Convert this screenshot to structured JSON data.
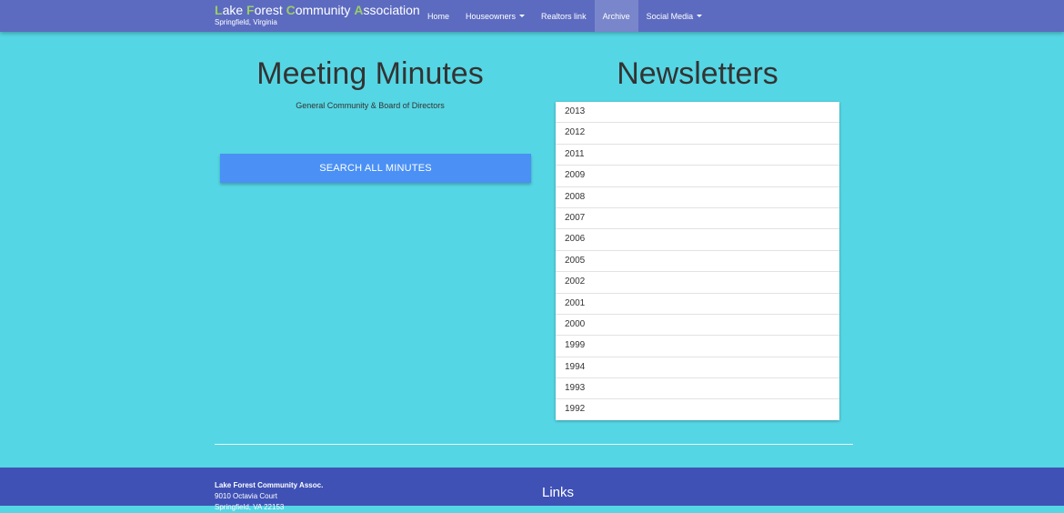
{
  "header": {
    "brand_initials": [
      "L",
      "F",
      "C",
      "A"
    ],
    "brand_rest": [
      "ake ",
      "orest ",
      "ommunity ",
      "ssociation"
    ],
    "brand_subtitle": "Springfield, Virginia",
    "nav": [
      {
        "label": "Home"
      },
      {
        "label": "Houseowners",
        "dropdown": true
      },
      {
        "label": "Realtors link"
      },
      {
        "label": "Archive",
        "active": true
      },
      {
        "label": "Social Media",
        "dropdown": true
      }
    ]
  },
  "minutes": {
    "title": "Meeting Minutes",
    "subtitle": "General Community & Board of Directors",
    "search_button": "SEARCH ALL MINUTES"
  },
  "newsletters": {
    "title": "Newsletters",
    "years": [
      "2013",
      "2012",
      "2011",
      "2009",
      "2008",
      "2007",
      "2006",
      "2005",
      "2002",
      "2001",
      "2000",
      "1999",
      "1994",
      "1993",
      "1992"
    ]
  },
  "footer": {
    "address": [
      "Lake Forest Community Assoc.",
      "9010 Octavia Court",
      "Springfield, VA 22153"
    ],
    "links_title": "Links"
  },
  "colors": {
    "background": "#55d6e4",
    "navbar": "#5c6bc0",
    "brand_initial": "#9ccc65",
    "button": "#4a90f5",
    "footer": "#3f51b5"
  }
}
